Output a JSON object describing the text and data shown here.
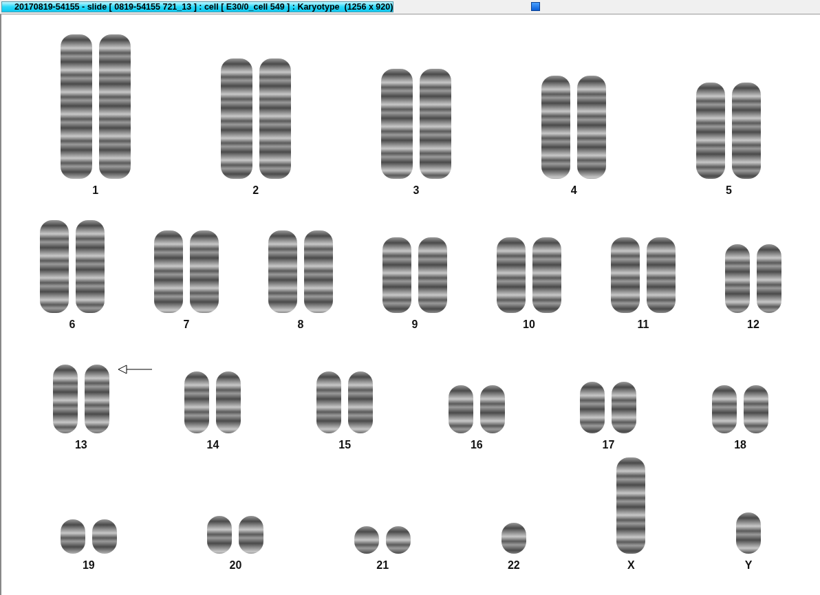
{
  "window": {
    "title": "20170819-54155 - slide [ 0819-54155 721_13 ] : cell [ E30/0_cell 549 ] : Karyotype  (1256 x 920)"
  },
  "karyotype": {
    "rows": [
      {
        "groups": [
          {
            "label": "1",
            "kind": "pair",
            "marked": false
          },
          {
            "label": "2",
            "kind": "pair",
            "marked": false
          },
          {
            "label": "3",
            "kind": "pair",
            "marked": false
          },
          {
            "label": "4",
            "kind": "pair",
            "marked": false
          },
          {
            "label": "5",
            "kind": "pair",
            "marked": false
          }
        ]
      },
      {
        "groups": [
          {
            "label": "6",
            "kind": "pair",
            "marked": false
          },
          {
            "label": "7",
            "kind": "pair",
            "marked": false
          },
          {
            "label": "8",
            "kind": "pair",
            "marked": false
          },
          {
            "label": "9",
            "kind": "pair",
            "marked": false
          },
          {
            "label": "10",
            "kind": "pair",
            "marked": false
          },
          {
            "label": "11",
            "kind": "pair",
            "marked": false
          },
          {
            "label": "12",
            "kind": "pair",
            "marked": false
          }
        ]
      },
      {
        "groups": [
          {
            "label": "13",
            "kind": "pair",
            "marked": true
          },
          {
            "label": "14",
            "kind": "pair",
            "marked": false
          },
          {
            "label": "15",
            "kind": "pair",
            "marked": false
          },
          {
            "label": "16",
            "kind": "pair",
            "marked": false
          },
          {
            "label": "17",
            "kind": "pair",
            "marked": false
          },
          {
            "label": "18",
            "kind": "pair",
            "marked": false
          }
        ]
      },
      {
        "groups": [
          {
            "label": "19",
            "kind": "pair",
            "marked": false
          },
          {
            "label": "20",
            "kind": "pair",
            "marked": false
          },
          {
            "label": "21",
            "kind": "pair",
            "marked": false
          },
          {
            "label": "22",
            "kind": "single",
            "marked": false
          },
          {
            "label": "X",
            "kind": "single",
            "marked": false
          },
          {
            "label": "Y",
            "kind": "single",
            "marked": false
          }
        ]
      }
    ]
  }
}
